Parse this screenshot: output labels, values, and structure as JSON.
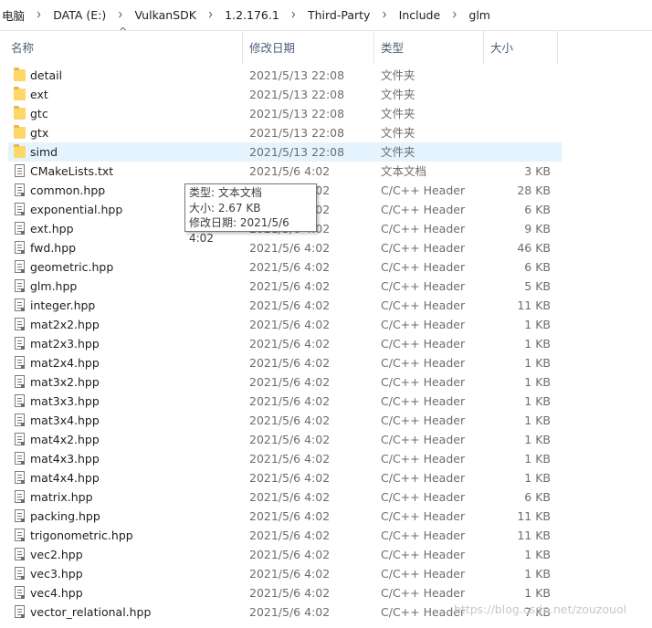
{
  "breadcrumb": [
    "电脑",
    "DATA (E:)",
    "VulkanSDK",
    "1.2.176.1",
    "Third-Party",
    "Include",
    "glm"
  ],
  "columns": {
    "name": "名称",
    "date": "修改日期",
    "type": "类型",
    "size": "大小"
  },
  "files": [
    {
      "name": "detail",
      "date": "2021/5/13 22:08",
      "type": "文件夹",
      "size": "",
      "icon": "folder-icon"
    },
    {
      "name": "ext",
      "date": "2021/5/13 22:08",
      "type": "文件夹",
      "size": "",
      "icon": "folder-icon"
    },
    {
      "name": "gtc",
      "date": "2021/5/13 22:08",
      "type": "文件夹",
      "size": "",
      "icon": "folder-icon"
    },
    {
      "name": "gtx",
      "date": "2021/5/13 22:08",
      "type": "文件夹",
      "size": "",
      "icon": "folder-icon"
    },
    {
      "name": "simd",
      "date": "2021/5/13 22:08",
      "type": "文件夹",
      "size": "",
      "icon": "folder-icon",
      "selected": true
    },
    {
      "name": "CMakeLists.txt",
      "date": "2021/5/6 4:02",
      "type": "文本文档",
      "size": "3 KB",
      "icon": "text-file-icon"
    },
    {
      "name": "common.hpp",
      "date": "2021/5/6 4:02",
      "type": "C/C++ Header",
      "size": "28 KB",
      "icon": "header-file-icon"
    },
    {
      "name": "exponential.hpp",
      "date": "2021/5/6 4:02",
      "type": "C/C++ Header",
      "size": "6 KB",
      "icon": "header-file-icon"
    },
    {
      "name": "ext.hpp",
      "date": "2021/5/6 4:02",
      "type": "C/C++ Header",
      "size": "9 KB",
      "icon": "header-file-icon"
    },
    {
      "name": "fwd.hpp",
      "date": "2021/5/6 4:02",
      "type": "C/C++ Header",
      "size": "46 KB",
      "icon": "header-file-icon"
    },
    {
      "name": "geometric.hpp",
      "date": "2021/5/6 4:02",
      "type": "C/C++ Header",
      "size": "6 KB",
      "icon": "header-file-icon"
    },
    {
      "name": "glm.hpp",
      "date": "2021/5/6 4:02",
      "type": "C/C++ Header",
      "size": "5 KB",
      "icon": "header-file-icon"
    },
    {
      "name": "integer.hpp",
      "date": "2021/5/6 4:02",
      "type": "C/C++ Header",
      "size": "11 KB",
      "icon": "header-file-icon"
    },
    {
      "name": "mat2x2.hpp",
      "date": "2021/5/6 4:02",
      "type": "C/C++ Header",
      "size": "1 KB",
      "icon": "header-file-icon"
    },
    {
      "name": "mat2x3.hpp",
      "date": "2021/5/6 4:02",
      "type": "C/C++ Header",
      "size": "1 KB",
      "icon": "header-file-icon"
    },
    {
      "name": "mat2x4.hpp",
      "date": "2021/5/6 4:02",
      "type": "C/C++ Header",
      "size": "1 KB",
      "icon": "header-file-icon"
    },
    {
      "name": "mat3x2.hpp",
      "date": "2021/5/6 4:02",
      "type": "C/C++ Header",
      "size": "1 KB",
      "icon": "header-file-icon"
    },
    {
      "name": "mat3x3.hpp",
      "date": "2021/5/6 4:02",
      "type": "C/C++ Header",
      "size": "1 KB",
      "icon": "header-file-icon"
    },
    {
      "name": "mat3x4.hpp",
      "date": "2021/5/6 4:02",
      "type": "C/C++ Header",
      "size": "1 KB",
      "icon": "header-file-icon"
    },
    {
      "name": "mat4x2.hpp",
      "date": "2021/5/6 4:02",
      "type": "C/C++ Header",
      "size": "1 KB",
      "icon": "header-file-icon"
    },
    {
      "name": "mat4x3.hpp",
      "date": "2021/5/6 4:02",
      "type": "C/C++ Header",
      "size": "1 KB",
      "icon": "header-file-icon"
    },
    {
      "name": "mat4x4.hpp",
      "date": "2021/5/6 4:02",
      "type": "C/C++ Header",
      "size": "1 KB",
      "icon": "header-file-icon"
    },
    {
      "name": "matrix.hpp",
      "date": "2021/5/6 4:02",
      "type": "C/C++ Header",
      "size": "6 KB",
      "icon": "header-file-icon"
    },
    {
      "name": "packing.hpp",
      "date": "2021/5/6 4:02",
      "type": "C/C++ Header",
      "size": "11 KB",
      "icon": "header-file-icon"
    },
    {
      "name": "trigonometric.hpp",
      "date": "2021/5/6 4:02",
      "type": "C/C++ Header",
      "size": "11 KB",
      "icon": "header-file-icon"
    },
    {
      "name": "vec2.hpp",
      "date": "2021/5/6 4:02",
      "type": "C/C++ Header",
      "size": "1 KB",
      "icon": "header-file-icon"
    },
    {
      "name": "vec3.hpp",
      "date": "2021/5/6 4:02",
      "type": "C/C++ Header",
      "size": "1 KB",
      "icon": "header-file-icon"
    },
    {
      "name": "vec4.hpp",
      "date": "2021/5/6 4:02",
      "type": "C/C++ Header",
      "size": "1 KB",
      "icon": "header-file-icon"
    },
    {
      "name": "vector_relational.hpp",
      "date": "2021/5/6 4:02",
      "type": "C/C++ Header",
      "size": "7 KB",
      "icon": "header-file-icon"
    }
  ],
  "tooltip": {
    "type_line": "类型: 文本文档",
    "size_line": "大小: 2.67 KB",
    "date_line": "修改日期: 2021/5/6 4:02"
  },
  "watermark": "https://blog.csdn.net/zouzouol",
  "colors": {
    "selection": "#e5f3ff",
    "folder": "#ffd766",
    "header_text": "#4c607a"
  }
}
